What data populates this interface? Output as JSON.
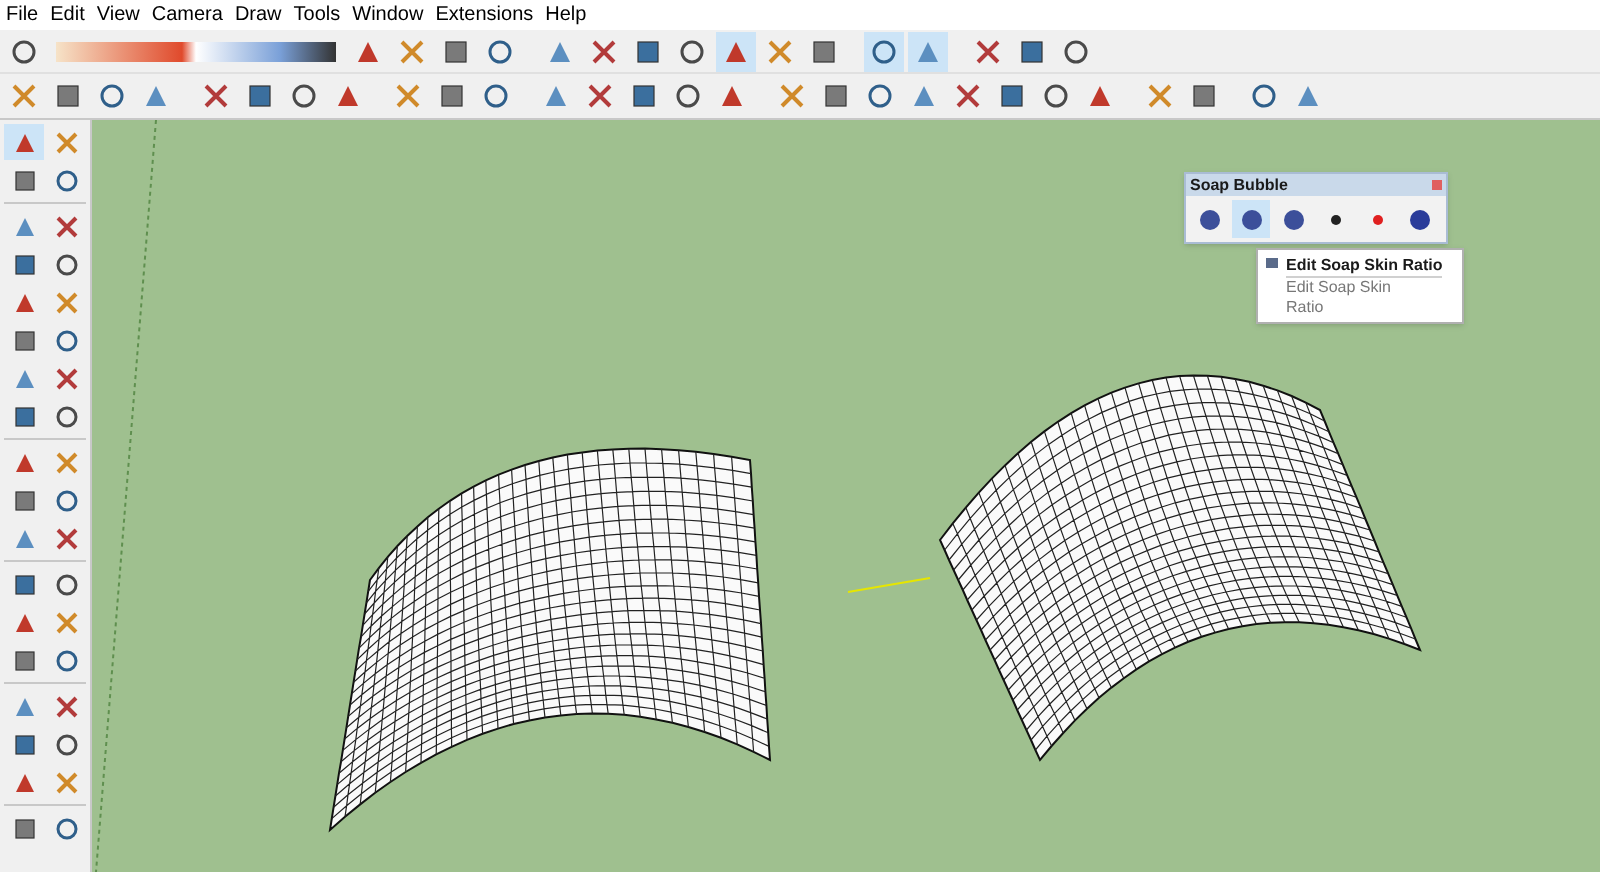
{
  "menu": [
    "File",
    "Edit",
    "View",
    "Camera",
    "Draw",
    "Tools",
    "Window",
    "Extensions",
    "Help"
  ],
  "top_row": [
    {
      "selected": false
    },
    {
      "selected": false
    },
    {
      "selected": false
    },
    {
      "selected": false
    },
    {
      "selected": false
    },
    {
      "selected": false
    },
    {
      "selected": false
    },
    {
      "selected": false
    },
    {
      "selected": false
    },
    {
      "selected": true
    },
    {
      "selected": false
    },
    {
      "selected": false
    },
    {
      "selected": true
    },
    {
      "selected": true
    },
    {
      "selected": false
    },
    {
      "selected": false
    },
    {
      "selected": false
    }
  ],
  "left_tools": [
    {
      "selected": true
    },
    {
      "selected": false
    },
    {
      "selected": false
    },
    {
      "selected": false
    }
  ],
  "soap_bubble": {
    "title": "Soap Bubble",
    "buttons": [
      {
        "selected": false
      },
      {
        "selected": true
      },
      {
        "selected": false
      },
      {
        "selected": false
      },
      {
        "selected": false
      },
      {
        "selected": false
      }
    ]
  },
  "tooltip": {
    "title": "Edit Soap Skin Ratio",
    "description": "Edit Soap Skin Ratio"
  }
}
